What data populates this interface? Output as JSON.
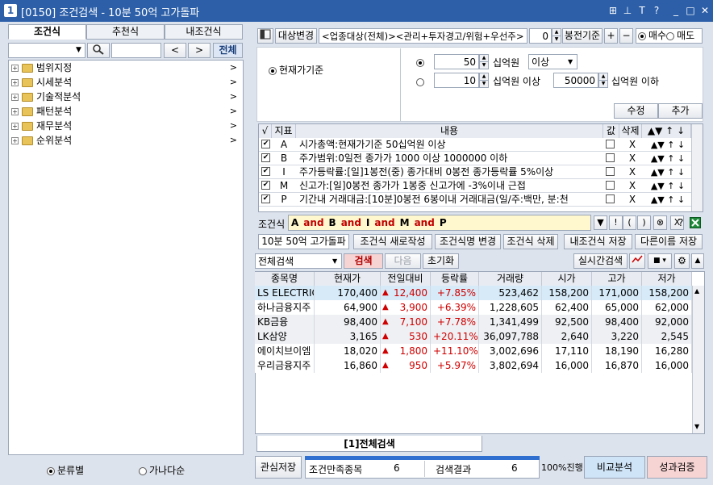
{
  "window": {
    "badge": "1",
    "title": "[0150] 조건검색 - 10분 50억 고가돌파",
    "controls": [
      "⊞",
      "⊥",
      "T",
      "?",
      "_",
      "□",
      "✕"
    ]
  },
  "left": {
    "tabs": [
      "조건식",
      "추천식",
      "내조건식"
    ],
    "search_btn_prev": "<",
    "search_btn_next": ">",
    "all_btn": "전체",
    "tree": [
      {
        "label": "범위지정"
      },
      {
        "label": "시세분석"
      },
      {
        "label": "기술적분석"
      },
      {
        "label": "패턴분석"
      },
      {
        "label": "재무분석"
      },
      {
        "label": "순위분석"
      }
    ],
    "radio_category": "분류별",
    "radio_alpha": "가나다순"
  },
  "toolbar": {
    "target_change": "대상변경",
    "target_text": "<업종대상(전체)><관리+투자경고/위험+우선주>",
    "bong_value": "0",
    "bong_label": "봉전기준",
    "plus": "+",
    "minus": "−",
    "buy": "매수",
    "sell": "매도"
  },
  "condition": {
    "current_price_basis": "현재가기준",
    "row1_value": "50",
    "row1_unit": "십억원",
    "row1_op": "이상",
    "row2_value": "10",
    "row2_unit": "십억원 이상",
    "row2_max": "50000",
    "row2_max_unit": "십억원 이하",
    "modify": "수정",
    "add": "추가"
  },
  "list": {
    "headers": {
      "check": "√",
      "idx": "지표",
      "content": "내용",
      "val": "값",
      "del": "삭제"
    },
    "rows": [
      {
        "id": "A",
        "text": "시가총액:현재가기준 50십억원 이상"
      },
      {
        "id": "B",
        "text": "주가범위:0일전 종가가 1000 이상 1000000 이하"
      },
      {
        "id": "I",
        "text": "주가등락률:[일]1봉전(중) 종가대비 0봉전 종가등락률 5%이상"
      },
      {
        "id": "M",
        "text": "신고가:[일]0봉전 종가가 1봉중 신고가에 -3%이내 근접"
      },
      {
        "id": "P",
        "text": "기간내 거래대금:[10분]0봉전 6봉이내 거래대금(일/주:백만, 분:천"
      }
    ],
    "row_ctl": {
      "x": "X",
      "up_solid": "▲",
      "down_solid": "▼",
      "up": "↑",
      "down": "↓"
    }
  },
  "formula": {
    "label": "조건식",
    "tokens": [
      "A",
      "and",
      "B",
      "and",
      "I",
      "and",
      "M",
      "and",
      "P"
    ],
    "btns": [
      "▼",
      "!",
      "(",
      ")",
      "⊗",
      "X",
      "?"
    ]
  },
  "actions": {
    "name": "10분 50억 고가돌파",
    "new": "조건식 새로작성",
    "rename": "조건식명 변경",
    "delete": "조건식 삭제",
    "save_mine": "내조건식 저장",
    "save_as": "다른이름 저장"
  },
  "search": {
    "scope": "전체검색",
    "search": "검색",
    "next": "다음",
    "reset": "초기화",
    "realtime": "실시간검색"
  },
  "results": {
    "headers": [
      "종목명",
      "현재가",
      "전일대비",
      "등락률",
      "거래량",
      "시가",
      "고가",
      "저가"
    ],
    "rows": [
      {
        "name": "LS ELECTRIC",
        "price": "170,400",
        "diff": "12,400",
        "rate": "+7.85%",
        "vol": "523,462",
        "open": "158,200",
        "high": "171,000",
        "low": "158,200"
      },
      {
        "name": "하나금융지주",
        "price": "64,900",
        "diff": "3,900",
        "rate": "+6.39%",
        "vol": "1,228,605",
        "open": "62,400",
        "high": "65,000",
        "low": "62,000"
      },
      {
        "name": "KB금융",
        "price": "98,400",
        "diff": "7,100",
        "rate": "+7.78%",
        "vol": "1,341,499",
        "open": "92,500",
        "high": "98,400",
        "low": "92,000"
      },
      {
        "name": "LK삼양",
        "price": "3,165",
        "diff": "530",
        "rate": "+20.11%",
        "vol": "36,097,788",
        "open": "2,640",
        "high": "3,220",
        "low": "2,545"
      },
      {
        "name": "에이치브이엠",
        "price": "18,020",
        "diff": "1,800",
        "rate": "+11.10%",
        "vol": "3,002,696",
        "open": "17,110",
        "high": "18,190",
        "low": "16,280"
      },
      {
        "name": "우리금융지주",
        "price": "16,860",
        "diff": "950",
        "rate": "+5.97%",
        "vol": "3,802,694",
        "open": "16,000",
        "high": "16,870",
        "low": "16,000"
      }
    ],
    "bottom_tab": "[1]전체검색"
  },
  "status": {
    "watch_save": "관심저장",
    "cond_label": "조건만족종목",
    "cond_count": "6",
    "res_label": "검색결과",
    "res_count": "6",
    "progress": "100%진행",
    "compare": "비교분석",
    "perf": "성과검증"
  }
}
